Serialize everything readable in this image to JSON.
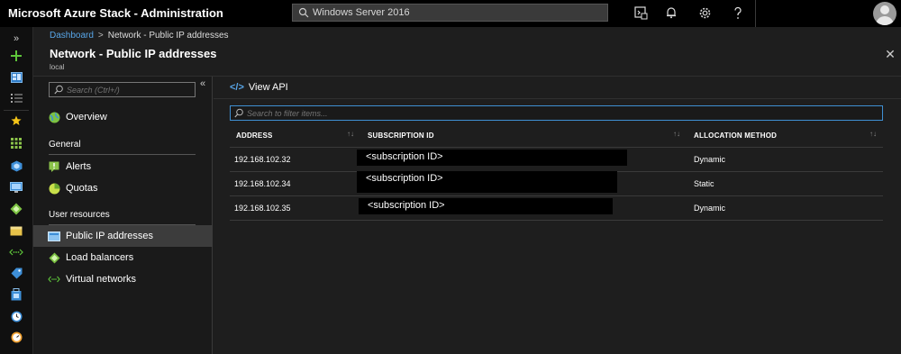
{
  "app": {
    "title": "Microsoft Azure Stack - Administration",
    "search_value": "Windows Server 2016"
  },
  "topbar_icons": [
    "cloud-shell-icon",
    "notifications-bell-icon",
    "settings-gear-icon",
    "help-question-icon",
    "user-avatar"
  ],
  "rail": {
    "expand_glyph": "»",
    "items": [
      "expand-icon",
      "create-plus-icon",
      "dashboard-icon",
      "all-services-icon",
      "favorites-star-icon",
      "marketplace-grid-icon",
      "resource-groups-icon",
      "virtual-machines-icon",
      "network-icon",
      "storage-icon",
      "virtual-networks-icon",
      "tags-icon",
      "keyvault-icon",
      "recent-clock-icon",
      "monitor-gauge-icon"
    ]
  },
  "breadcrumb": {
    "link": "Dashboard",
    "separator": ">",
    "current": "Network - Public IP addresses"
  },
  "blade": {
    "title": "Network - Public IP addresses",
    "subtitle": "local",
    "close_glyph": "✕"
  },
  "menu": {
    "search_placeholder": "Search (Ctrl+/)",
    "collapse_glyph": "«",
    "overview": "Overview",
    "section_general": "General",
    "alerts": "Alerts",
    "quotas": "Quotas",
    "section_user_resources": "User resources",
    "public_ip": "Public IP addresses",
    "load_balancers": "Load balancers",
    "virtual_networks": "Virtual networks"
  },
  "toolbar": {
    "view_api_glyph": "</>",
    "view_api": "View API"
  },
  "filter": {
    "placeholder": "Search to filter items..."
  },
  "grid": {
    "columns": [
      "ADDRESS",
      "SUBSCRIPTION ID",
      "ALLOCATION METHOD"
    ],
    "sort_glyph": "↑↓",
    "rows": [
      {
        "address": "192.168.102.32",
        "subscription": "<subscription ID>",
        "allocation": "Dynamic"
      },
      {
        "address": "192.168.102.34",
        "subscription": "<subscription ID>",
        "allocation": "Static"
      },
      {
        "address": "192.168.102.35",
        "subscription": "<subscription ID>",
        "allocation": "Dynamic"
      }
    ]
  },
  "colors": {
    "accent": "#3f8fd2",
    "link": "#58a6e8",
    "active_menu": "#3c3c3c",
    "background": "#1e1e1e"
  }
}
